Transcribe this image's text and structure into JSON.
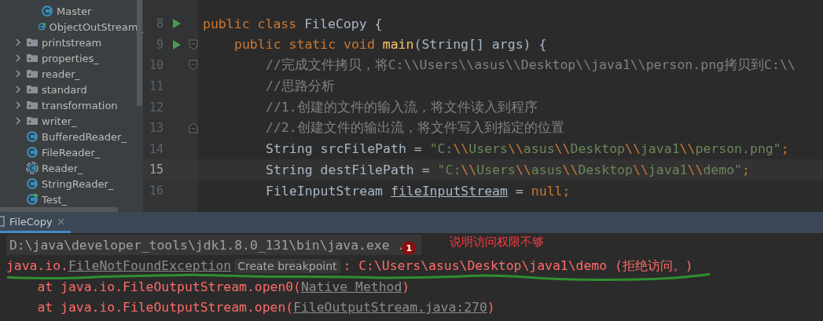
{
  "project_tree": {
    "continued_children": [
      {
        "label": "Master",
        "kind": "class"
      },
      {
        "label": "ObjectOutStream_",
        "kind": "runnable-class"
      }
    ],
    "items": [
      {
        "label": "printstream",
        "kind": "folder",
        "expanded": false
      },
      {
        "label": "properties_",
        "kind": "folder",
        "expanded": false
      },
      {
        "label": "reader_",
        "kind": "folder",
        "expanded": false
      },
      {
        "label": "standard",
        "kind": "folder",
        "expanded": false
      },
      {
        "label": "transformation",
        "kind": "folder",
        "expanded": false
      },
      {
        "label": "writer_",
        "kind": "folder",
        "expanded": false
      },
      {
        "label": "BufferedReader_",
        "kind": "class"
      },
      {
        "label": "FileReader_",
        "kind": "class"
      },
      {
        "label": "Reader_",
        "kind": "abstract-class"
      },
      {
        "label": "StringReader_",
        "kind": "class"
      },
      {
        "label": "Test_",
        "kind": "runnable-class"
      }
    ]
  },
  "code_lines": [
    {
      "number": "8",
      "runnable": true,
      "current": false,
      "segments": [
        {
          "kind": "keyword",
          "text": "public class "
        },
        {
          "kind": "plain",
          "text": "FileCopy {"
        }
      ],
      "children": [
        {
          "number": "9",
          "runnable": true,
          "kind": "fold-start",
          "current": false,
          "segments": [
            {
              "kind": "keyword",
              "text": "public static void "
            },
            {
              "kind": "method",
              "text": "main"
            },
            {
              "kind": "plain",
              "text": "(String[] args) {"
            }
          ],
          "children": [
            {
              "number": "10",
              "runnable": false,
              "kind": "fold-start",
              "current": false,
              "segments": [
                {
                  "kind": "comment",
                  "text": "//完成文件拷贝，将C:\\\\Users\\\\asus\\\\Desktop\\\\java1\\\\person.png拷贝到C:\\\\"
                }
              ]
            },
            {
              "number": "11",
              "runnable": false,
              "current": false,
              "segments": [
                {
                  "kind": "comment",
                  "text": "//思路分析"
                }
              ]
            },
            {
              "number": "12",
              "runnable": false,
              "current": false,
              "segments": [
                {
                  "kind": "comment",
                  "text": "//1.创建的文件的输入流，将文件读入到程序"
                }
              ]
            },
            {
              "number": "13",
              "runnable": false,
              "kind": "fold-end",
              "current": false,
              "segments": [
                {
                  "kind": "comment",
                  "text": "//2.创建文件的输出流，将文件写入到指定的位置"
                }
              ]
            },
            {
              "number": "14",
              "runnable": false,
              "current": false,
              "segments": [
                {
                  "kind": "plain",
                  "text": "String srcFilePath = "
                },
                {
                  "kind": "string",
                  "text": "\"C:"
                },
                {
                  "kind": "escape",
                  "text": "\\\\"
                },
                {
                  "kind": "string",
                  "text": "Users"
                },
                {
                  "kind": "escape",
                  "text": "\\\\"
                },
                {
                  "kind": "string",
                  "text": "asus"
                },
                {
                  "kind": "escape",
                  "text": "\\\\"
                },
                {
                  "kind": "string",
                  "text": "Desktop"
                },
                {
                  "kind": "escape",
                  "text": "\\\\"
                },
                {
                  "kind": "string",
                  "text": "java1"
                },
                {
                  "kind": "escape",
                  "text": "\\\\"
                },
                {
                  "kind": "string",
                  "text": "person.png\""
                },
                {
                  "kind": "keyword",
                  "text": ";"
                }
              ]
            },
            {
              "number": "15",
              "runnable": false,
              "current": true,
              "segments": [
                {
                  "kind": "plain",
                  "text": "String destFilePath = "
                },
                {
                  "kind": "string",
                  "text": "\"C:"
                },
                {
                  "kind": "escape",
                  "text": "\\\\"
                },
                {
                  "kind": "string",
                  "text": "Users"
                },
                {
                  "kind": "escape",
                  "text": "\\\\"
                },
                {
                  "kind": "string",
                  "text": "asus"
                },
                {
                  "kind": "escape",
                  "text": "\\\\"
                },
                {
                  "kind": "string",
                  "text": "Desktop"
                },
                {
                  "kind": "escape",
                  "text": "\\\\"
                },
                {
                  "kind": "string",
                  "text": "java1"
                },
                {
                  "kind": "escape",
                  "text": "\\\\"
                },
                {
                  "kind": "string",
                  "text": "demo\""
                },
                {
                  "kind": "keyword",
                  "text": ";"
                }
              ]
            },
            {
              "number": "16",
              "runnable": false,
              "current": false,
              "segments": [
                {
                  "kind": "plain",
                  "text": "FileInputStream "
                },
                {
                  "kind": "variable",
                  "text": "fileInputStream"
                },
                {
                  "kind": "plain",
                  "text": " = "
                },
                {
                  "kind": "keyword",
                  "text": "null;"
                }
              ]
            }
          ]
        }
      ]
    }
  ],
  "run_panel": {
    "tab": {
      "label": "FileCopy",
      "selected": true
    },
    "lines": [
      {
        "selected": true,
        "badge": "1",
        "segments": [
          {
            "kind": "command",
            "text": "D:\\java\\developer_tools\\jdk1.8.0_131\\bin\\java.exe ."
          }
        ]
      },
      {
        "selected": false,
        "segments": [
          {
            "kind": "error",
            "text": "java.io."
          },
          {
            "kind": "link",
            "text": "FileNotFoundException"
          },
          {
            "kind": "hint",
            "text": "Create breakpoint"
          },
          {
            "kind": "error",
            "text": ": C:\\Users\\asus\\Desktop\\java1\\demo (拒绝访问。)"
          }
        ]
      },
      {
        "selected": false,
        "segments": [
          {
            "kind": "error",
            "text": "    at java.io.FileOutputStream.open0("
          },
          {
            "kind": "link",
            "text": "Native Method"
          },
          {
            "kind": "error",
            "text": ")"
          }
        ]
      },
      {
        "selected": false,
        "segments": [
          {
            "kind": "error",
            "text": "    at java.io.FileOutputStream.open("
          },
          {
            "kind": "link",
            "text": "FileOutputStream.java:270"
          },
          {
            "kind": "error",
            "text": ")"
          }
        ]
      }
    ],
    "annotation": "说明访问权限不够"
  }
}
